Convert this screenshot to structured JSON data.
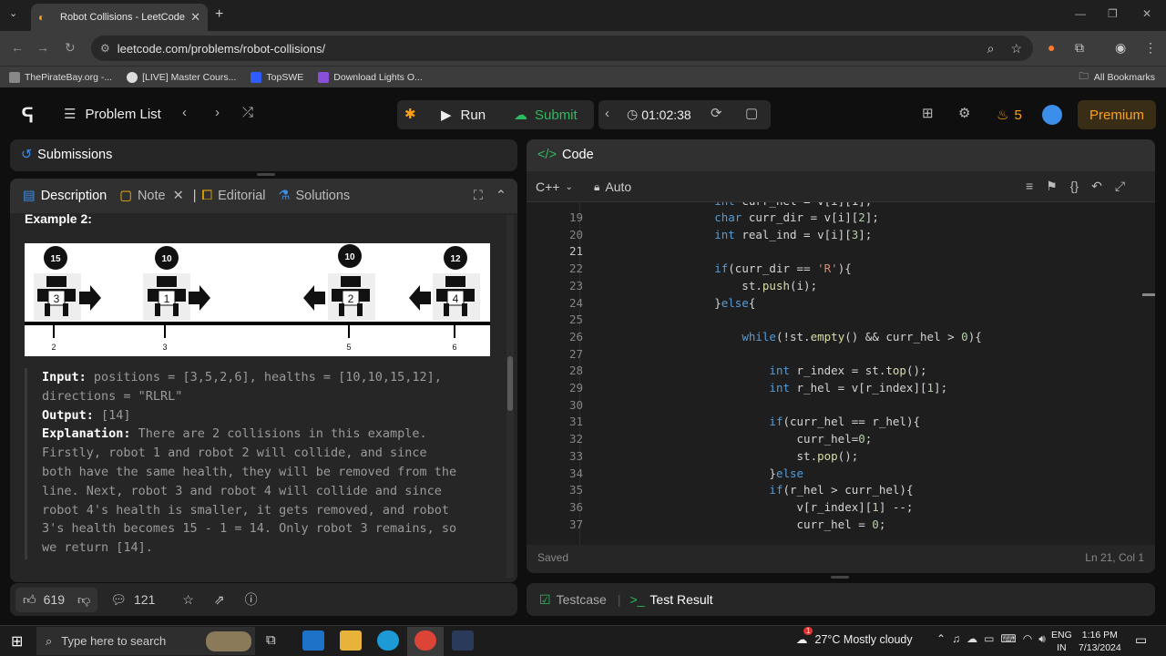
{
  "browser": {
    "tab_title": "Robot Collisions - LeetCode",
    "url": "leetcode.com/problems/robot-collisions/",
    "bookmarks": [
      "ThePirateBay.org -...",
      "[LIVE] Master Cours...",
      "TopSWE",
      "Download Lights O..."
    ],
    "all_bookmarks": "All Bookmarks"
  },
  "lc_nav": {
    "problem_list": "Problem List",
    "run": "Run",
    "submit": "Submit",
    "timer": "01:02:38",
    "streak": "5",
    "premium": "Premium"
  },
  "left": {
    "submissions": "Submissions",
    "tabs": [
      "Description",
      "Note",
      "Editorial",
      "Solutions"
    ],
    "example_title": "Example 2:",
    "robots": [
      {
        "health": "15",
        "id": "3",
        "dir": "right",
        "pos": "2"
      },
      {
        "health": "10",
        "id": "1",
        "dir": "right",
        "pos": "3"
      },
      {
        "health": "10",
        "id": "2",
        "dir": "left",
        "pos": "5"
      },
      {
        "health": "12",
        "id": "4",
        "dir": "left",
        "pos": "6"
      }
    ],
    "input_label": "Input:",
    "input_text": " positions = [3,5,2,6], healths = [10,10,15,12],",
    "input_text2": "directions = \"RLRL\"",
    "output_label": "Output:",
    "output_text": " [14]",
    "explanation_label": "Explanation:",
    "explanation_lines": [
      " There are 2 collisions in this example.",
      "Firstly, robot 1 and robot 2 will collide, and since",
      "both have the same health, they will be removed from the",
      "line. Next, robot 3 and robot 4 will collide and since",
      "robot 4's health is smaller, it gets removed, and robot",
      "3's health becomes 15 - 1 = 14. Only robot 3 remains, so",
      "we return [14]."
    ],
    "likes": "619",
    "comments": "121"
  },
  "code": {
    "title": "Code",
    "language": "C++",
    "mode": "Auto",
    "status": "Saved",
    "cursor": "Ln 21, Col 1",
    "lines": [
      {
        "n": "19",
        "t": "        char curr_dir = v[i][2];"
      },
      {
        "n": "20",
        "t": "        int real_ind = v[i][3];"
      },
      {
        "n": "21",
        "t": ""
      },
      {
        "n": "22",
        "t": "        if(curr_dir == 'R'){"
      },
      {
        "n": "23",
        "t": "            st.push(i);"
      },
      {
        "n": "24",
        "t": "        }else{"
      },
      {
        "n": "25",
        "t": ""
      },
      {
        "n": "26",
        "t": "            while(!st.empty() && curr_hel > 0){"
      },
      {
        "n": "27",
        "t": ""
      },
      {
        "n": "28",
        "t": "                int r_index = st.top();"
      },
      {
        "n": "29",
        "t": "                int r_hel = v[r_index][1];"
      },
      {
        "n": "30",
        "t": ""
      },
      {
        "n": "31",
        "t": "                if(curr_hel == r_hel){"
      },
      {
        "n": "32",
        "t": "                    curr_hel=0;"
      },
      {
        "n": "33",
        "t": "                    st.pop();"
      },
      {
        "n": "34",
        "t": "                }else"
      },
      {
        "n": "35",
        "t": "                if(r_hel > curr_hel){"
      },
      {
        "n": "36",
        "t": "                    v[r_index][1] --;"
      },
      {
        "n": "37",
        "t": "                    curr_hel = 0;"
      }
    ]
  },
  "result_tabs": [
    "Testcase",
    "Test Result"
  ],
  "taskbar": {
    "search_placeholder": "Type here to search",
    "weather": "27°C  Mostly cloudy",
    "lang1": "ENG",
    "lang2": "IN",
    "time": "1:16 PM",
    "date": "7/13/2024",
    "weather_badge": "1"
  },
  "colors": {
    "accent": "#ffa116",
    "submit_green": "#2cbb5d",
    "panel": "#262626"
  }
}
